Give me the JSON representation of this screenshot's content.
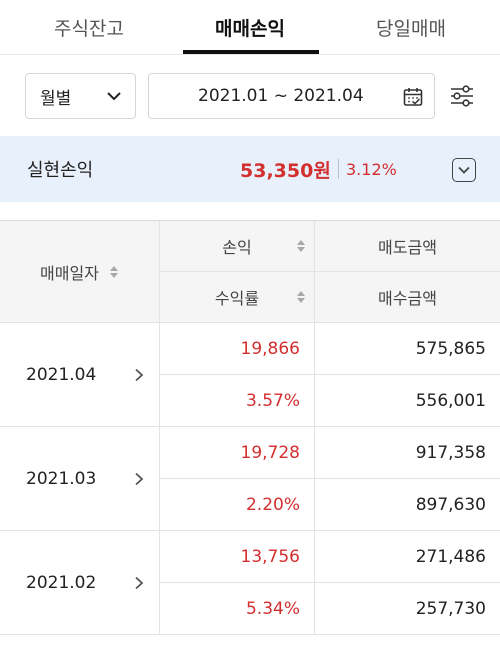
{
  "tabs": [
    {
      "label": "주식잔고"
    },
    {
      "label": "매매손익"
    },
    {
      "label": "당일매매"
    }
  ],
  "filters": {
    "period_select": "월별",
    "date_range": "2021.01 ~ 2021.04"
  },
  "summary": {
    "label": "실현손익",
    "amount": "53,350원",
    "rate": "3.12%"
  },
  "table": {
    "headers": {
      "date": "매매일자",
      "profit": "손익",
      "yield": "수익률",
      "sell_amount": "매도금액",
      "buy_amount": "매수금액"
    },
    "rows": [
      {
        "date": "2021.04",
        "profit": "19,866",
        "yield": "3.57%",
        "sell": "575,865",
        "buy": "556,001"
      },
      {
        "date": "2021.03",
        "profit": "19,728",
        "yield": "2.20%",
        "sell": "917,358",
        "buy": "897,630"
      },
      {
        "date": "2021.02",
        "profit": "13,756",
        "yield": "5.34%",
        "sell": "271,486",
        "buy": "257,730"
      }
    ]
  },
  "colors": {
    "profit_red": "#d32f2f",
    "summary_bg": "#e8f0fb",
    "header_bg": "#f5f5f5"
  }
}
